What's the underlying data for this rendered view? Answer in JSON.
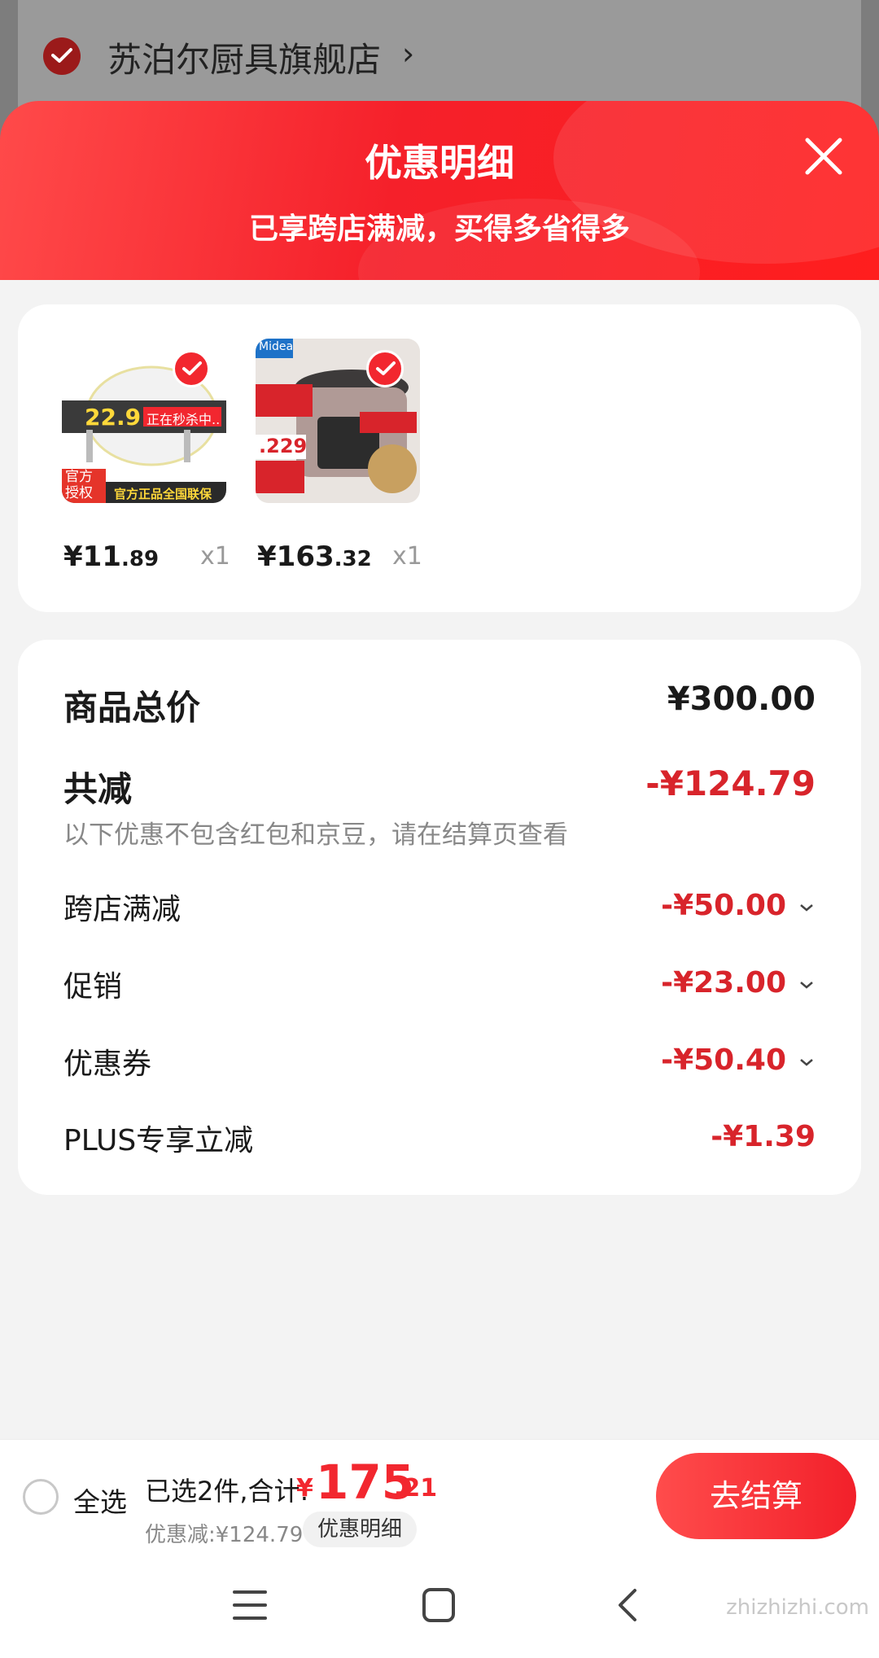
{
  "store": {
    "name": "苏泊尔厨具旗舰店",
    "chevron": "›"
  },
  "header": {
    "title": "优惠明细",
    "subtitle": "已享跨店满减，买得多省得多"
  },
  "items": [
    {
      "price_main": "¥11",
      "price_dec": ".89",
      "qty": "x1",
      "thumb_texts": {
        "badge": "22.9",
        "promo": "正在秒杀中..",
        "official": "官方授权",
        "slogan": "官方正品全国联保"
      }
    },
    {
      "price_main": "¥163",
      "price_dec": ".32",
      "qty": "x1",
      "thumb_texts": {
        "brand": "Midea",
        "price": ".229"
      }
    }
  ],
  "summary": {
    "total_label": "商品总价",
    "total_value": "¥300.00",
    "discount_label": "共减",
    "discount_value": "-¥124.79",
    "note": "以下优惠不包含红包和京豆，请在结算页查看",
    "rows": [
      {
        "label": "跨店满减",
        "value": "-¥50.00"
      },
      {
        "label": "促销",
        "value": "-¥23.00"
      },
      {
        "label": "优惠券",
        "value": "-¥50.40"
      },
      {
        "label": "PLUS专享立减",
        "value": "-¥1.39"
      }
    ]
  },
  "bottom": {
    "select_all": "全选",
    "selected_text": "已选2件,合计:",
    "currency": "¥",
    "total_int": "175",
    "total_dec": ".21",
    "discount_text": "优惠减:¥124.79",
    "detail_button": "优惠明细",
    "checkout_button": "去结算"
  },
  "watermark": "zhizhizhi.com",
  "colors": {
    "accent": "#f2272f",
    "discount_red": "#d8242b"
  }
}
